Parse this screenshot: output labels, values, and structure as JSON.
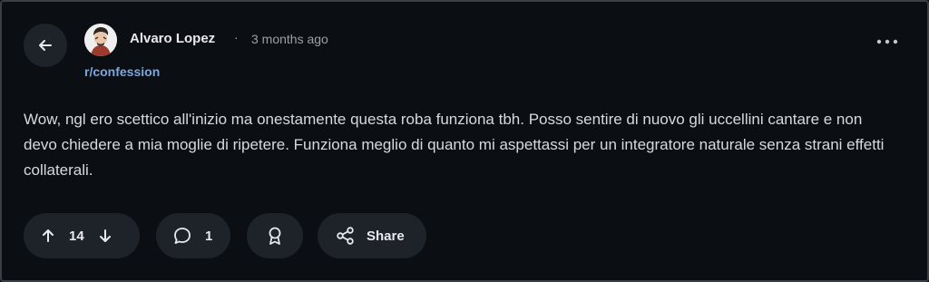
{
  "post": {
    "author": "Alvaro Lopez",
    "separator": "·",
    "time": "3 months ago",
    "subreddit": "r/confession",
    "body": "Wow, ngl ero scettico all'inizio ma onestamente questa roba funziona tbh. Posso sentire di nuovo gli uccellini cantare e non devo chiedere a mia moglie di ripetere. Funziona meglio di quanto mi aspettassi per un integratore naturale senza strani effetti collaterali."
  },
  "actions": {
    "score": "14",
    "comments": "1",
    "share_label": "Share"
  },
  "icons": {
    "back": "arrow-left-icon",
    "more": "more-horizontal-icon",
    "upvote": "arrow-up-icon",
    "downvote": "arrow-down-icon",
    "comment": "comment-bubble-icon",
    "award": "award-icon",
    "share": "share-icon"
  },
  "colors": {
    "background": "#0b0f14",
    "pill": "#1e2329",
    "subreddit_link": "#7ba7e0"
  }
}
